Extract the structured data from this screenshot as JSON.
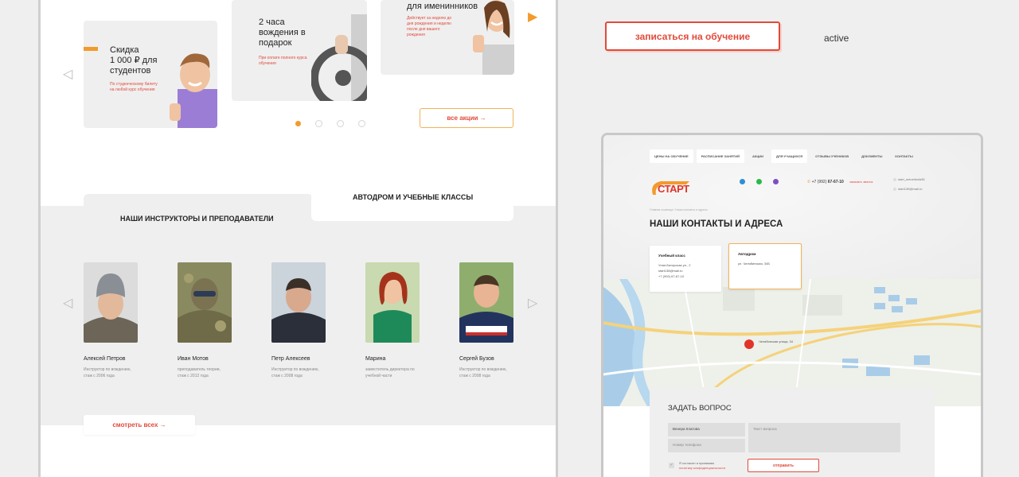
{
  "promos": [
    {
      "title": "Скидка\n1 000 ₽ для\nстудентов",
      "desc": "По студенческому билету\nна любой курс обучения"
    },
    {
      "title": "2 часа\nвождения в\nподарок",
      "desc": "При оплате полного курса\nобучения"
    },
    {
      "title": "для именинников",
      "desc": "Действует за неделю до\nдня рождения и неделю\nпосле дня вашего\nрождения"
    }
  ],
  "all_promos_label": "все акции →",
  "tabs": {
    "instructors": "НАШИ ИНСТРУКТОРЫ И ПРЕПОДАВАТЕЛИ",
    "autodrom": "АВТОДРОМ И УЧЕБНЫЕ КЛАССЫ"
  },
  "instructors": [
    {
      "name": "Алексей Петров",
      "role": "Инструктор по вождению,\nстаж с 2006 года"
    },
    {
      "name": "Иван Мотов",
      "role": "преподаватель теории,\nстаж с 2012 года"
    },
    {
      "name": "Петр Алексеев",
      "role": "Инструктор по вождению,\nстаж с 2008 года"
    },
    {
      "name": "Марина",
      "role": "заместитель директора по\nучебной части"
    },
    {
      "name": "Сергей Бузов",
      "role": "Инструктор по вождению,\nстаж с 2008 года"
    }
  ],
  "see_all_label": "смотреть всех →",
  "signup_label": "записаться на обучение",
  "active_label": "active",
  "mock": {
    "nav": [
      "ЦЕНЫ НА ОБУЧЕНИЕ",
      "РАСПИСАНИЕ ЗАНЯТИЙ",
      "АКЦИИ",
      "ДЛЯ УЧАЩИХСЯ",
      "ОТЗЫВЫ УЧЕНИКОВ",
      "ДОКУМЕНТЫ",
      "КОНТАКТЫ"
    ],
    "logo": "СТАРТ",
    "phone_prefix": "+7 (992) ",
    "phone_main": "67-67-10",
    "callback": "заказать звонок",
    "emails": [
      "start_avtoshkola36",
      "start138@mail.ru"
    ],
    "crumbs": "Главная страница  /  Наши контакты и адреса",
    "title": "НАШИ КОНТАКТЫ И АДРЕСА",
    "cards": [
      {
        "heading": "Учебный класс",
        "lines": [
          "Улан-Баторская ул., 2",
          "start138@mail.ru",
          "+7 (992) 67-67-10"
        ]
      },
      {
        "heading": "Автодром",
        "lines": [
          "ул. Челябинская, 34Б"
        ]
      }
    ],
    "map_label": "Челябинская улица, 34",
    "form": {
      "title": "ЗАДАТЬ ВОПРОС",
      "name_value": "Венера Клатова",
      "phone_placeholder": "Номер телефона",
      "text_placeholder": "Текст вопроса",
      "consent_text": "Я согласен и принимаю",
      "consent_link": "политику конфиденциальности",
      "send_label": "отправить"
    }
  },
  "colors": {
    "accent_red": "#e14a3a",
    "accent_orange": "#f39a2c",
    "panel_gray": "#efefef"
  }
}
